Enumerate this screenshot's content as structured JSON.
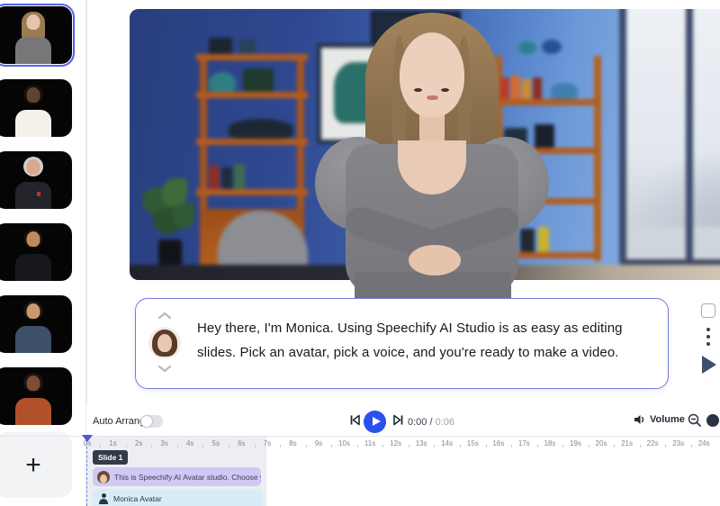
{
  "colors": {
    "accent_play": "#2b50ee",
    "caption_border": "#767bd9",
    "selected_ring": "#4f62f2",
    "badge_bg": "#333b49"
  },
  "sidebar": {
    "add_label": "+",
    "avatars": [
      {
        "name": "monica-selected",
        "selected": true,
        "hair": "#9a7c52",
        "hair_long": true,
        "skin": "#e5c3ad",
        "shirt": "#77777a",
        "accent": ""
      },
      {
        "name": "man-white-shirt",
        "selected": false,
        "hair": "#17100c",
        "hair_long": false,
        "skin": "#5f4433",
        "shirt": "#f3f1e9",
        "accent": ""
      },
      {
        "name": "older-man-suit",
        "selected": false,
        "hair": "#cfcfcf",
        "hair_long": false,
        "skin": "#d9a98c",
        "shirt": "#23242a",
        "accent": "#c03030"
      },
      {
        "name": "man-black-shirt",
        "selected": false,
        "hair": "#14100d",
        "hair_long": false,
        "skin": "#bd8a5e",
        "shirt": "#17181c",
        "accent": ""
      },
      {
        "name": "man-navy-shirt",
        "selected": false,
        "hair": "#1a1410",
        "hair_long": false,
        "skin": "#c9996f",
        "shirt": "#3c5068",
        "accent": ""
      },
      {
        "name": "woman-rust-top",
        "selected": false,
        "hair": "#1a130f",
        "hair_long": false,
        "skin": "#7d4e33",
        "shirt": "#b2502c",
        "accent": ""
      }
    ]
  },
  "caption": {
    "text": "Hey there, I'm Monica. Using Speechify AI Studio is as easy as editing slides. Pick an avatar, pick a voice, and you're ready to make a video."
  },
  "toolbar": {
    "auto_arrange_label": "Auto Arrange",
    "volume_label": "Volume",
    "time_current": "0:00",
    "time_separator": " / ",
    "time_total": "0:06"
  },
  "timeline": {
    "slide_badge": "Slide 1",
    "ruler": [
      "0s",
      "1s",
      "2s",
      "3s",
      "4s",
      "5s",
      "6s",
      "7s",
      "8s",
      "9s",
      "10s",
      "11s",
      "12s",
      "13s",
      "14s",
      "15s",
      "16s",
      "17s",
      "18s",
      "19s",
      "20s",
      "21s",
      "22s",
      "23s",
      "24s"
    ],
    "tracks": [
      {
        "id": "script",
        "label": "This is Speechify AI Avatar studio. Choose your av.",
        "color": "#cfc9f3"
      },
      {
        "id": "avatar",
        "label": "Monica Avatar",
        "color": "#d6edf7"
      }
    ]
  }
}
